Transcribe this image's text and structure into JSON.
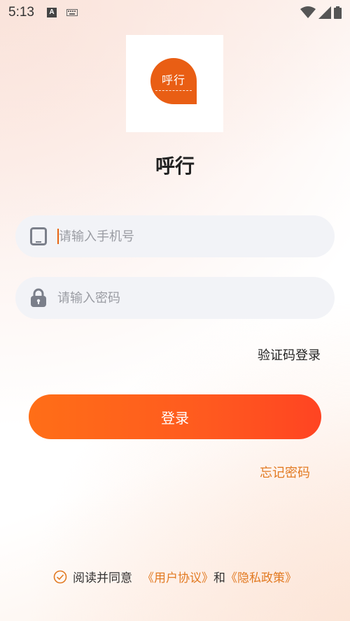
{
  "status_bar": {
    "time": "5:13",
    "icons": [
      "accessibility-a-icon",
      "keyboard-icon",
      "wifi-icon",
      "signal-icon",
      "battery-icon"
    ]
  },
  "logo": {
    "text": "呼行",
    "brand_color": "#e95e14"
  },
  "app_name": "呼行",
  "phone_field": {
    "placeholder": "请输入手机号",
    "value": "",
    "icon": "phone-icon"
  },
  "password_field": {
    "placeholder": "请输入密码",
    "value": "",
    "icon": "lock-icon"
  },
  "sms_login_label": "验证码登录",
  "login_button_label": "登录",
  "forgot_password_label": "忘记密码",
  "agreement": {
    "prefix": "阅读并同意",
    "user_agreement": "《用户协议》",
    "conjunction": "和",
    "privacy_policy": "《隐私政策》",
    "checked": true
  },
  "colors": {
    "accent": "#e27a22",
    "button_start": "#ff6e17",
    "button_end": "#ff4422",
    "field_bg": "#f2f3f7"
  }
}
